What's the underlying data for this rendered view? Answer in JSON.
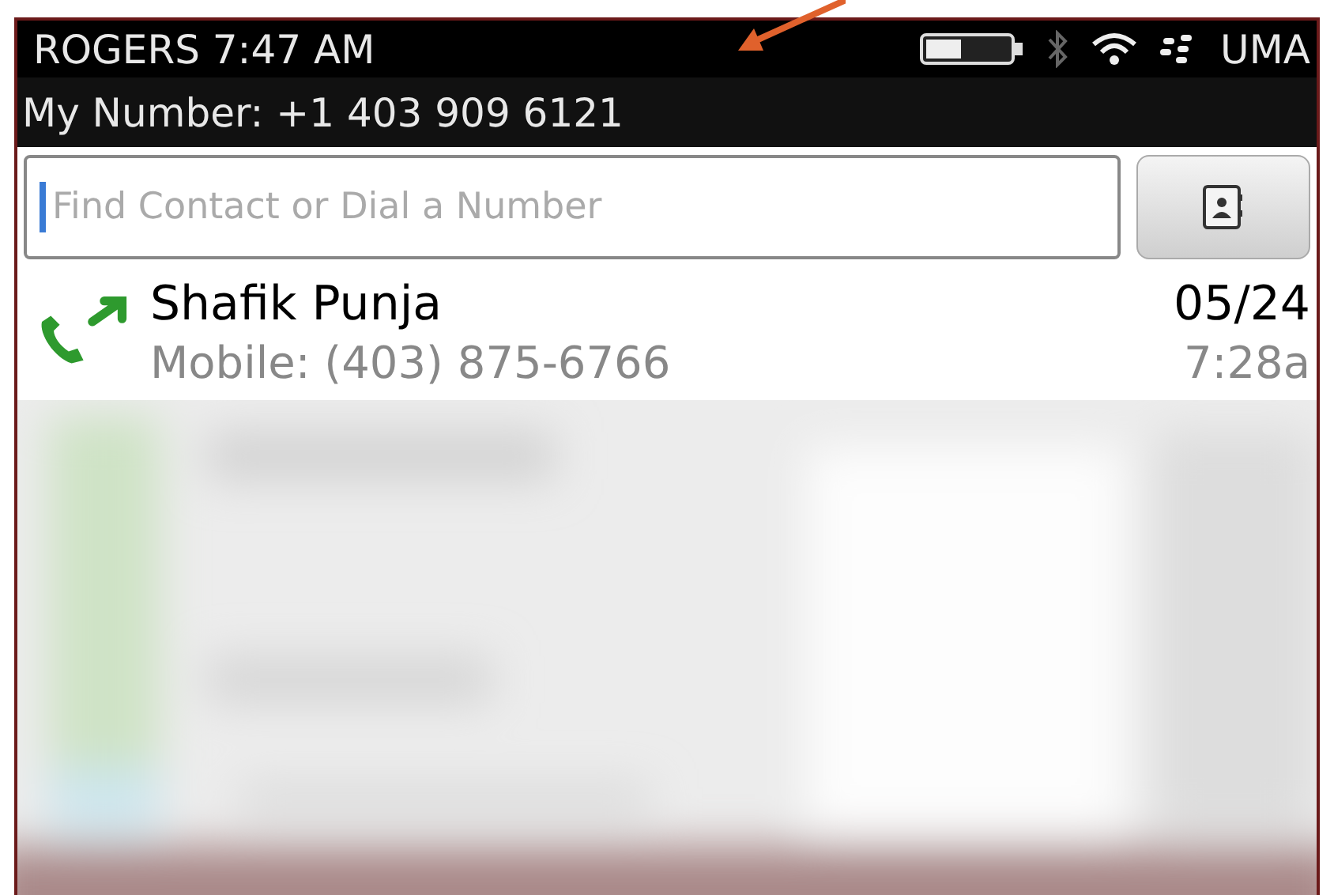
{
  "status_bar": {
    "carrier_time": "ROGERS 7:47 AM",
    "network": "UMA"
  },
  "my_number": "My Number: +1 403 909 6121",
  "search": {
    "placeholder": "Find Contact or Dial a Number"
  },
  "calls": [
    {
      "kind": "outgoing",
      "name": "Shafik Punja",
      "detail": "Mobile: (403) 875-6766",
      "date": "05/24",
      "time": "7:28a"
    }
  ]
}
